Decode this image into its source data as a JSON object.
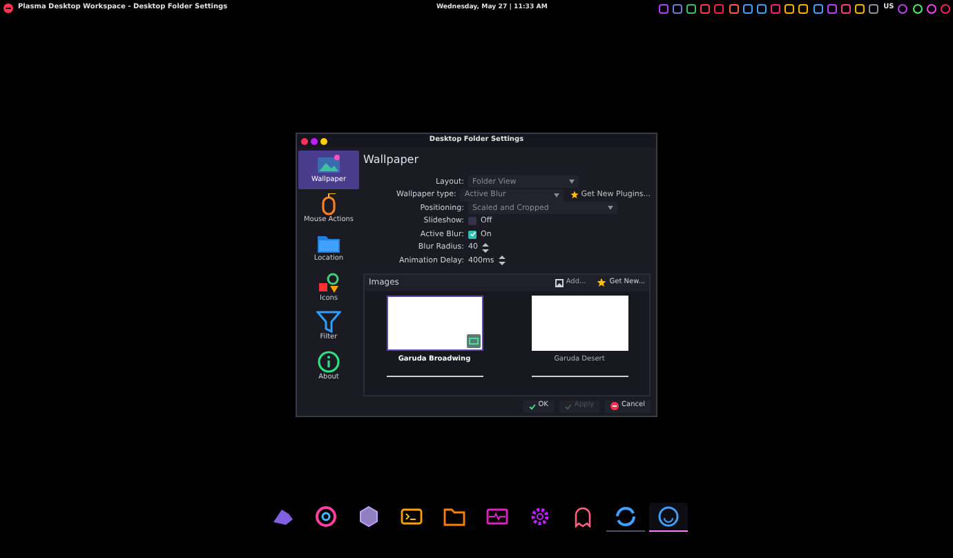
{
  "top_bar": {
    "title": "Plasma Desktop Workspace - Desktop Folder Settings",
    "clock": "Wednesday, May 27 | 11:33 AM",
    "keyboard_layout": "US"
  },
  "dialog": {
    "title": "Desktop Folder Settings",
    "sidebar": [
      {
        "label": "Wallpaper",
        "kind": "wallpaper",
        "selected": true
      },
      {
        "label": "Mouse Actions",
        "kind": "mouse",
        "selected": false
      },
      {
        "label": "Location",
        "kind": "folder",
        "selected": false
      },
      {
        "label": "Icons",
        "kind": "icons",
        "selected": false
      },
      {
        "label": "Filter",
        "kind": "filter",
        "selected": false
      },
      {
        "label": "About",
        "kind": "about",
        "selected": false
      }
    ],
    "heading": "Wallpaper",
    "settings": [
      {
        "kind": "select",
        "label": "Layout:",
        "value": "Folder View"
      },
      {
        "kind": "select",
        "label": "Wallpaper type:",
        "value": "Active Blur",
        "action": "Get New Plugins..."
      },
      {
        "kind": "select",
        "label": "Positioning:",
        "value": "Scaled and Cropped"
      },
      {
        "kind": "check",
        "label": "Slideshow:",
        "value": "Off",
        "checked": false
      },
      {
        "kind": "check",
        "label": "Active Blur:",
        "value": "On",
        "checked": true
      },
      {
        "kind": "spin",
        "label": "Blur Radius:",
        "value": "40"
      },
      {
        "kind": "spin",
        "label": "Animation Delay:",
        "value": "400ms"
      }
    ],
    "images_header": {
      "title": "Images",
      "add": "Add...",
      "get_new": "Get New..."
    },
    "images": [
      {
        "name": "Garuda Broadwing",
        "selected": true
      },
      {
        "name": "Garuda Desert",
        "selected": false
      }
    ],
    "buttons": [
      {
        "label": "OK",
        "kind": "ok",
        "disabled": false
      },
      {
        "label": "Apply",
        "kind": "apply",
        "disabled": true
      },
      {
        "label": "Cancel",
        "kind": "cancel",
        "disabled": false
      }
    ]
  },
  "dock": [
    {
      "kind": "hat",
      "running": false,
      "selected": false
    },
    {
      "kind": "browser",
      "running": false,
      "selected": false
    },
    {
      "kind": "hexagon",
      "running": false,
      "selected": false
    },
    {
      "kind": "terminal",
      "running": false,
      "selected": false
    },
    {
      "kind": "folder",
      "running": false,
      "selected": false
    },
    {
      "kind": "monitor",
      "running": false,
      "selected": false
    },
    {
      "kind": "gear",
      "running": false,
      "selected": false
    },
    {
      "kind": "ghost",
      "running": false,
      "selected": false
    },
    {
      "kind": "sync",
      "running": true,
      "selected": false
    },
    {
      "kind": "smile",
      "running": true,
      "selected": true
    }
  ]
}
